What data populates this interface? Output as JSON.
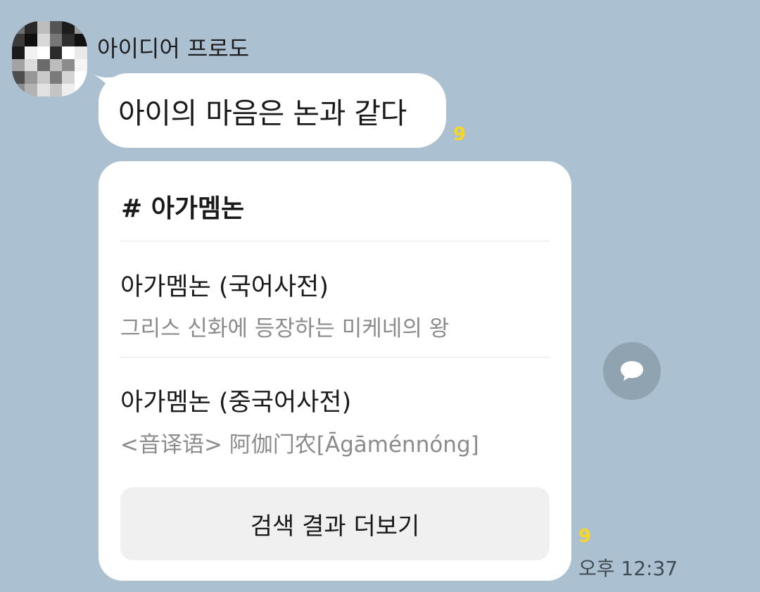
{
  "chat": {
    "sender_name": "아이디어 프로도",
    "message_text": "아이의 마음은 논과 같다",
    "message_unread_count": "9"
  },
  "search_card": {
    "title": "# 아가멤논",
    "entries": [
      {
        "title": "아가멤논 (국어사전)",
        "description": "그리스 신화에 등장하는 미케네의 왕"
      },
      {
        "title": "아가멤논 (중국어사전)",
        "description": "<音译语> 阿伽门农[Āgāménnóng]"
      }
    ],
    "more_button_label": "검색 결과 더보기",
    "unread_count": "9",
    "timestamp": "오후 12:37"
  },
  "icons": {
    "avatar": "pixelated-avatar",
    "share": "speech-bubble-icon"
  },
  "colors": {
    "chat_background": "#abc1d1",
    "bubble": "#ffffff",
    "unread_badge": "#f7d722",
    "share_button": "#8fa3b1"
  }
}
